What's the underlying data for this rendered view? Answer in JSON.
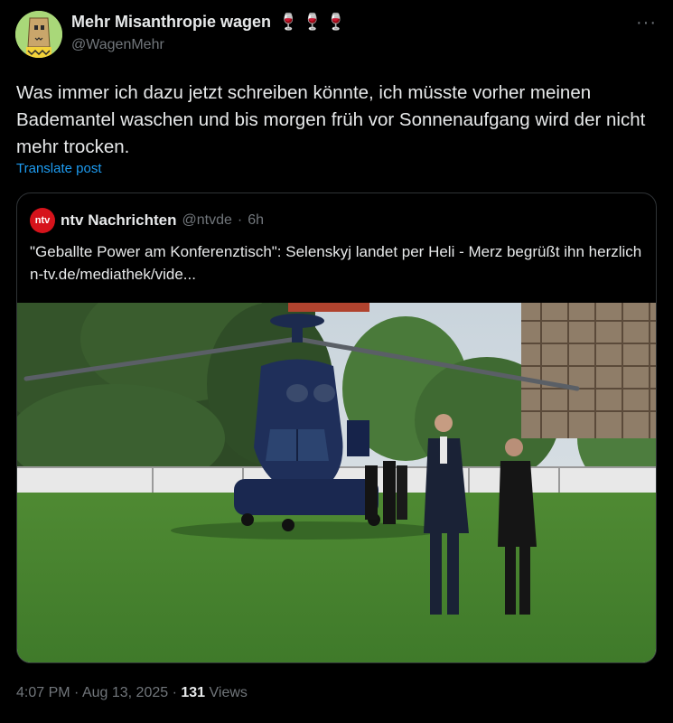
{
  "author": {
    "display_name": "Mehr Misanthropie wagen",
    "name_emojis": "🍷🍷🍷",
    "handle": "@WagenMehr"
  },
  "more_icon": "more-horizontal-icon",
  "tweet": {
    "text": "Was immer ich dazu jetzt schreiben könnte, ich müsste vorher meinen Bademantel waschen und bis morgen früh vor Sonnenaufgang wird der nicht mehr trocken.",
    "translate_label": "Translate post"
  },
  "quote": {
    "logo_text": "ntv",
    "name": "ntv Nachrichten",
    "handle": "@ntvde",
    "separator": "·",
    "time": "6h",
    "text": "\"Geballte Power am Konferenztisch\": Selenskyj landet per Heli - Merz begrüßt ihn herzlich n-tv.de/mediathek/vide..."
  },
  "meta": {
    "time": "4:07 PM",
    "dot1": "·",
    "date": "Aug 13, 2025",
    "dot2": "·",
    "views_count": "131",
    "views_label": "Views"
  },
  "colors": {
    "background": "#000000",
    "text_primary": "#e7e9ea",
    "text_secondary": "#71767b",
    "link": "#1d9bf0",
    "ntv_red": "#d6131b",
    "border": "#2f3336"
  }
}
